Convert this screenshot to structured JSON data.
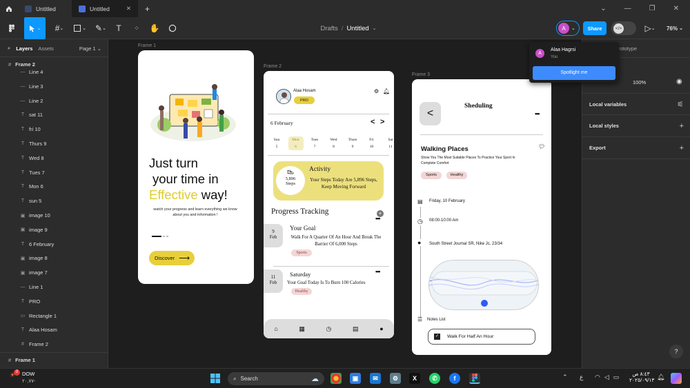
{
  "window_tabs": [
    {
      "label": "Untitled"
    },
    {
      "label": "Untitled"
    }
  ],
  "toolbar": {
    "breadcrumb_parent": "Drafts",
    "breadcrumb_sep": "/",
    "file_name": "Untitled",
    "avatar_letter": "A",
    "share_label": "Share",
    "zoom": "76%"
  },
  "left_panel": {
    "tab_layers": "Layers",
    "tab_assets": "Assets",
    "page": "Page 1",
    "root": "Frame 2",
    "layers": [
      {
        "icon": "—",
        "label": "Line 4"
      },
      {
        "icon": "—",
        "label": "Line 3"
      },
      {
        "icon": "—",
        "label": "Line 2"
      },
      {
        "icon": "T",
        "label": "sat 11"
      },
      {
        "icon": "T",
        "label": "fri 10"
      },
      {
        "icon": "T",
        "label": "Thurs 9"
      },
      {
        "icon": "T",
        "label": "Wed 8"
      },
      {
        "icon": "T",
        "label": "Tues 7"
      },
      {
        "icon": "T",
        "label": "Mon 6"
      },
      {
        "icon": "T",
        "label": "sun 5"
      },
      {
        "icon": "▣",
        "label": "image 10"
      },
      {
        "icon": "▣",
        "label": "image 9"
      },
      {
        "icon": "T",
        "label": "6 February"
      },
      {
        "icon": "▣",
        "label": "image 8"
      },
      {
        "icon": "▣",
        "label": "image 7"
      },
      {
        "icon": "—",
        "label": "Line 1"
      },
      {
        "icon": "T",
        "label": "PRO"
      },
      {
        "icon": "▭",
        "label": "Rectangle 1"
      },
      {
        "icon": "T",
        "label": "Alaa Hosam"
      },
      {
        "icon": "#",
        "label": "Frame 2"
      }
    ],
    "footer": "Frame 1"
  },
  "right_panel": {
    "tab": "Prototype",
    "opacity": "100%",
    "sections": [
      "Local variables",
      "Local styles",
      "Export"
    ]
  },
  "popup": {
    "user": "Alaa Hagrsi",
    "sub": "You",
    "button": "Spotlight me"
  },
  "frame1": {
    "label": "Frame 1",
    "h1": "Just turn",
    "h2": "your time in",
    "h3a": "Effective",
    "h3b": " way!",
    "desc": "watch your progress and learn everything we know about you and information !",
    "button": "Discover"
  },
  "frame2": {
    "label": "Frame 2",
    "name": "Alaa Hosam",
    "badge": "PRO",
    "month": "6 February",
    "days": [
      {
        "d": "Sun",
        "n": "5"
      },
      {
        "d": "Mon",
        "n": "6"
      },
      {
        "d": "Tues",
        "n": "7"
      },
      {
        "d": "Wed",
        "n": "8"
      },
      {
        "d": "Thurs",
        "n": "9"
      },
      {
        "d": "Fri",
        "n": "10"
      },
      {
        "d": "Sat",
        "n": "11"
      }
    ],
    "steps_num": "5,896",
    "steps_word": "Steps",
    "activity": "Activity",
    "activity_text": "Your Steps Today Are 5,896 Steps, Keep Moving Forward",
    "progress_title": "Progress Tracking",
    "goal1": {
      "day": "9",
      "mon": "Feb",
      "title": "Your Goal",
      "text": "Walk For A Quarter Of An Hour And Break The Barrier Of 6,000 Steps",
      "tag": "Sports"
    },
    "goal2": {
      "day": "11",
      "mon": "Feb",
      "title": "Saturday",
      "text": "Your Goal Today Is To Burn 100 Calories",
      "tag": "Healthy"
    }
  },
  "frame3": {
    "label": "Frame 3",
    "title": "Sheduling",
    "back": "<",
    "heading": "Walking Places",
    "desc": "Show You The Most Suitable Places To Practice Your Sport In Complete Comfort",
    "tags": [
      "Sports",
      "Healthy"
    ],
    "date": "Friday, 10 February",
    "time": "08:00-10:00 Am",
    "address": "South Street Journal SR, Nike Jc, 23/34",
    "notes_label": "Notes List",
    "note": "Walk For Half An Hour"
  },
  "taskbar": {
    "weather_title": "DOW",
    "weather_val": "٢٠,٧٧-",
    "search": "Search",
    "time": "٨:٤٣ ص",
    "date": "٢٠٢٥/٠٩/١٣",
    "lang": "ع",
    "badge": "0"
  }
}
